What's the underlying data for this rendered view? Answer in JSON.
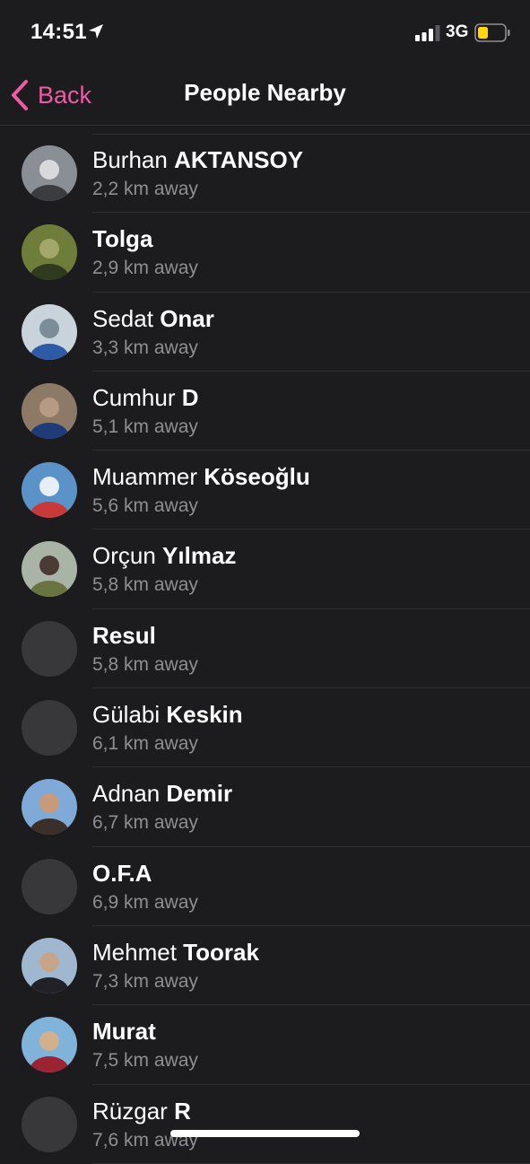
{
  "status_bar": {
    "time": "14:51",
    "network": "3G",
    "battery_color": "#ffd60a",
    "icons": [
      "location-arrow-icon",
      "signal-bars-icon",
      "battery-icon"
    ]
  },
  "nav": {
    "back_label": "Back",
    "title": "People Nearby",
    "accent_color": "#ee5aa6"
  },
  "people": [
    {
      "first": "Burhan",
      "last": "AKTANSOY",
      "distance": "2,2 km away",
      "has_photo": true,
      "photo_colors": [
        "#8a8f96",
        "#3a3c40",
        "#d8d9db"
      ]
    },
    {
      "first": "Tolga",
      "last": "",
      "distance": "2,9 km away",
      "has_photo": true,
      "photo_colors": [
        "#6f7d3a",
        "#2f3a1e",
        "#a3a86a"
      ]
    },
    {
      "first": "Sedat",
      "last": "Onar",
      "distance": "3,3 km away",
      "has_photo": true,
      "photo_colors": [
        "#c9d3dc",
        "#2e5aa8",
        "#7a8e9a"
      ]
    },
    {
      "first": "Cumhur",
      "last": "D",
      "distance": "5,1 km away",
      "has_photo": true,
      "photo_colors": [
        "#8c7a66",
        "#1f3c78",
        "#b79a82"
      ]
    },
    {
      "first": "Muammer",
      "last": "Köseoğlu",
      "distance": "5,6 km away",
      "has_photo": true,
      "photo_colors": [
        "#5b93c9",
        "#c83a3a",
        "#e8eef5"
      ]
    },
    {
      "first": "Orçun",
      "last": "Yılmaz",
      "distance": "5,8 km away",
      "has_photo": true,
      "photo_colors": [
        "#a9b3a6",
        "#6a7440",
        "#4a3c34"
      ]
    },
    {
      "first": "Resul",
      "last": "",
      "distance": "5,8 km away",
      "has_photo": false
    },
    {
      "first": "Gülabi",
      "last": "Keskin",
      "distance": "6,1 km away",
      "has_photo": false
    },
    {
      "first": "Adnan",
      "last": "Demir",
      "distance": "6,7 km away",
      "has_photo": true,
      "photo_colors": [
        "#7fa9d6",
        "#3a3029",
        "#c89a7a"
      ]
    },
    {
      "first": "O.F.A",
      "last": "",
      "distance": "6,9 km away",
      "has_photo": false
    },
    {
      "first": "Mehmet",
      "last": "Toorak",
      "distance": "7,3 km away",
      "has_photo": true,
      "photo_colors": [
        "#9fb8d0",
        "#222226",
        "#c6a48a"
      ]
    },
    {
      "first": "Murat",
      "last": "",
      "distance": "7,5 km away",
      "has_photo": true,
      "photo_colors": [
        "#7fb3d9",
        "#9c2333",
        "#d2b08e"
      ]
    },
    {
      "first": "Rüzgar",
      "last": "R",
      "distance": "7,6 km away",
      "has_photo": false
    }
  ]
}
